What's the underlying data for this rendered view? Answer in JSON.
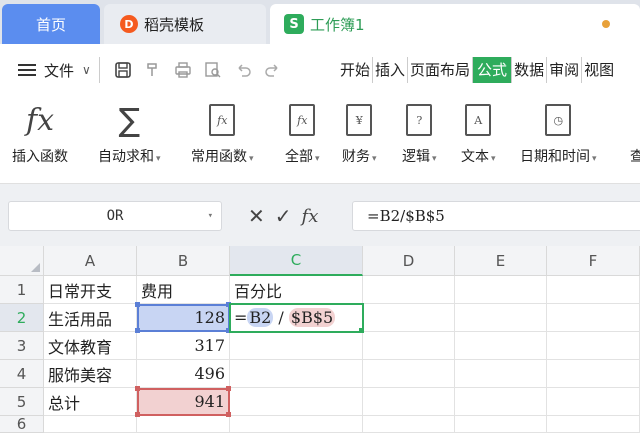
{
  "tabs": {
    "home": "首页",
    "template": "稻壳模板",
    "template_logo": "D",
    "document": "工作簿1",
    "document_logo": "S"
  },
  "menu": {
    "file": "文件",
    "ribbon_tabs": [
      "开始",
      "插入",
      "页面布局",
      "公式",
      "数据",
      "审阅",
      "视图"
    ],
    "active_tab": "公式"
  },
  "ribbon": {
    "insert_function": "插入函数",
    "autosum": "自动求和",
    "common_functions": "常用函数",
    "all": "全部",
    "finance": "财务",
    "logic": "逻辑",
    "text": "文本",
    "datetime": "日期和时间",
    "overflow": "查"
  },
  "formula_bar": {
    "name_box": "OR",
    "formula": "=B2/$B$5"
  },
  "sheet": {
    "columns": [
      "A",
      "B",
      "C",
      "D",
      "E",
      "F"
    ],
    "rows": [
      "1",
      "2",
      "3",
      "4",
      "5",
      "6"
    ],
    "a": [
      "日常开支",
      "生活用品",
      "文体教育",
      "服饰美容",
      "总计"
    ],
    "b1": "费用",
    "b": [
      "128",
      "317",
      "496",
      "941"
    ],
    "c1": "百分比",
    "c2_parts": {
      "eq": "=",
      "ref1": "B2",
      "op": " / ",
      "ref2": "$B$5"
    }
  },
  "colors": {
    "accent": "#2eac5c",
    "home_tab": "#5b8def",
    "ref_blue": "#5b7fd6",
    "ref_red": "#d06060"
  },
  "icons": [
    "hamburger-icon",
    "save-icon",
    "format-painter-icon",
    "print-icon",
    "print-preview-icon",
    "undo-icon",
    "redo-icon",
    "cancel-icon",
    "confirm-icon",
    "fx-icon"
  ]
}
